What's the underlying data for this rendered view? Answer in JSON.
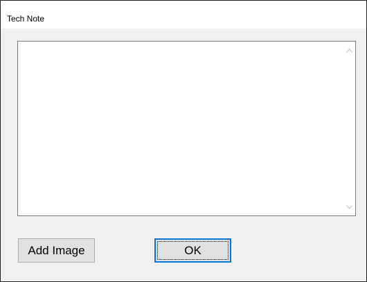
{
  "window": {
    "title": "Tech Note"
  },
  "note": {
    "text": ""
  },
  "buttons": {
    "add_image_label": "Add Image",
    "ok_label": "OK"
  },
  "icons": {
    "scroll_up": "chevron-up-icon",
    "scroll_down": "chevron-down-icon"
  },
  "colors": {
    "dialog_background": "#f0f0f0",
    "focus_border": "#0078d7"
  }
}
